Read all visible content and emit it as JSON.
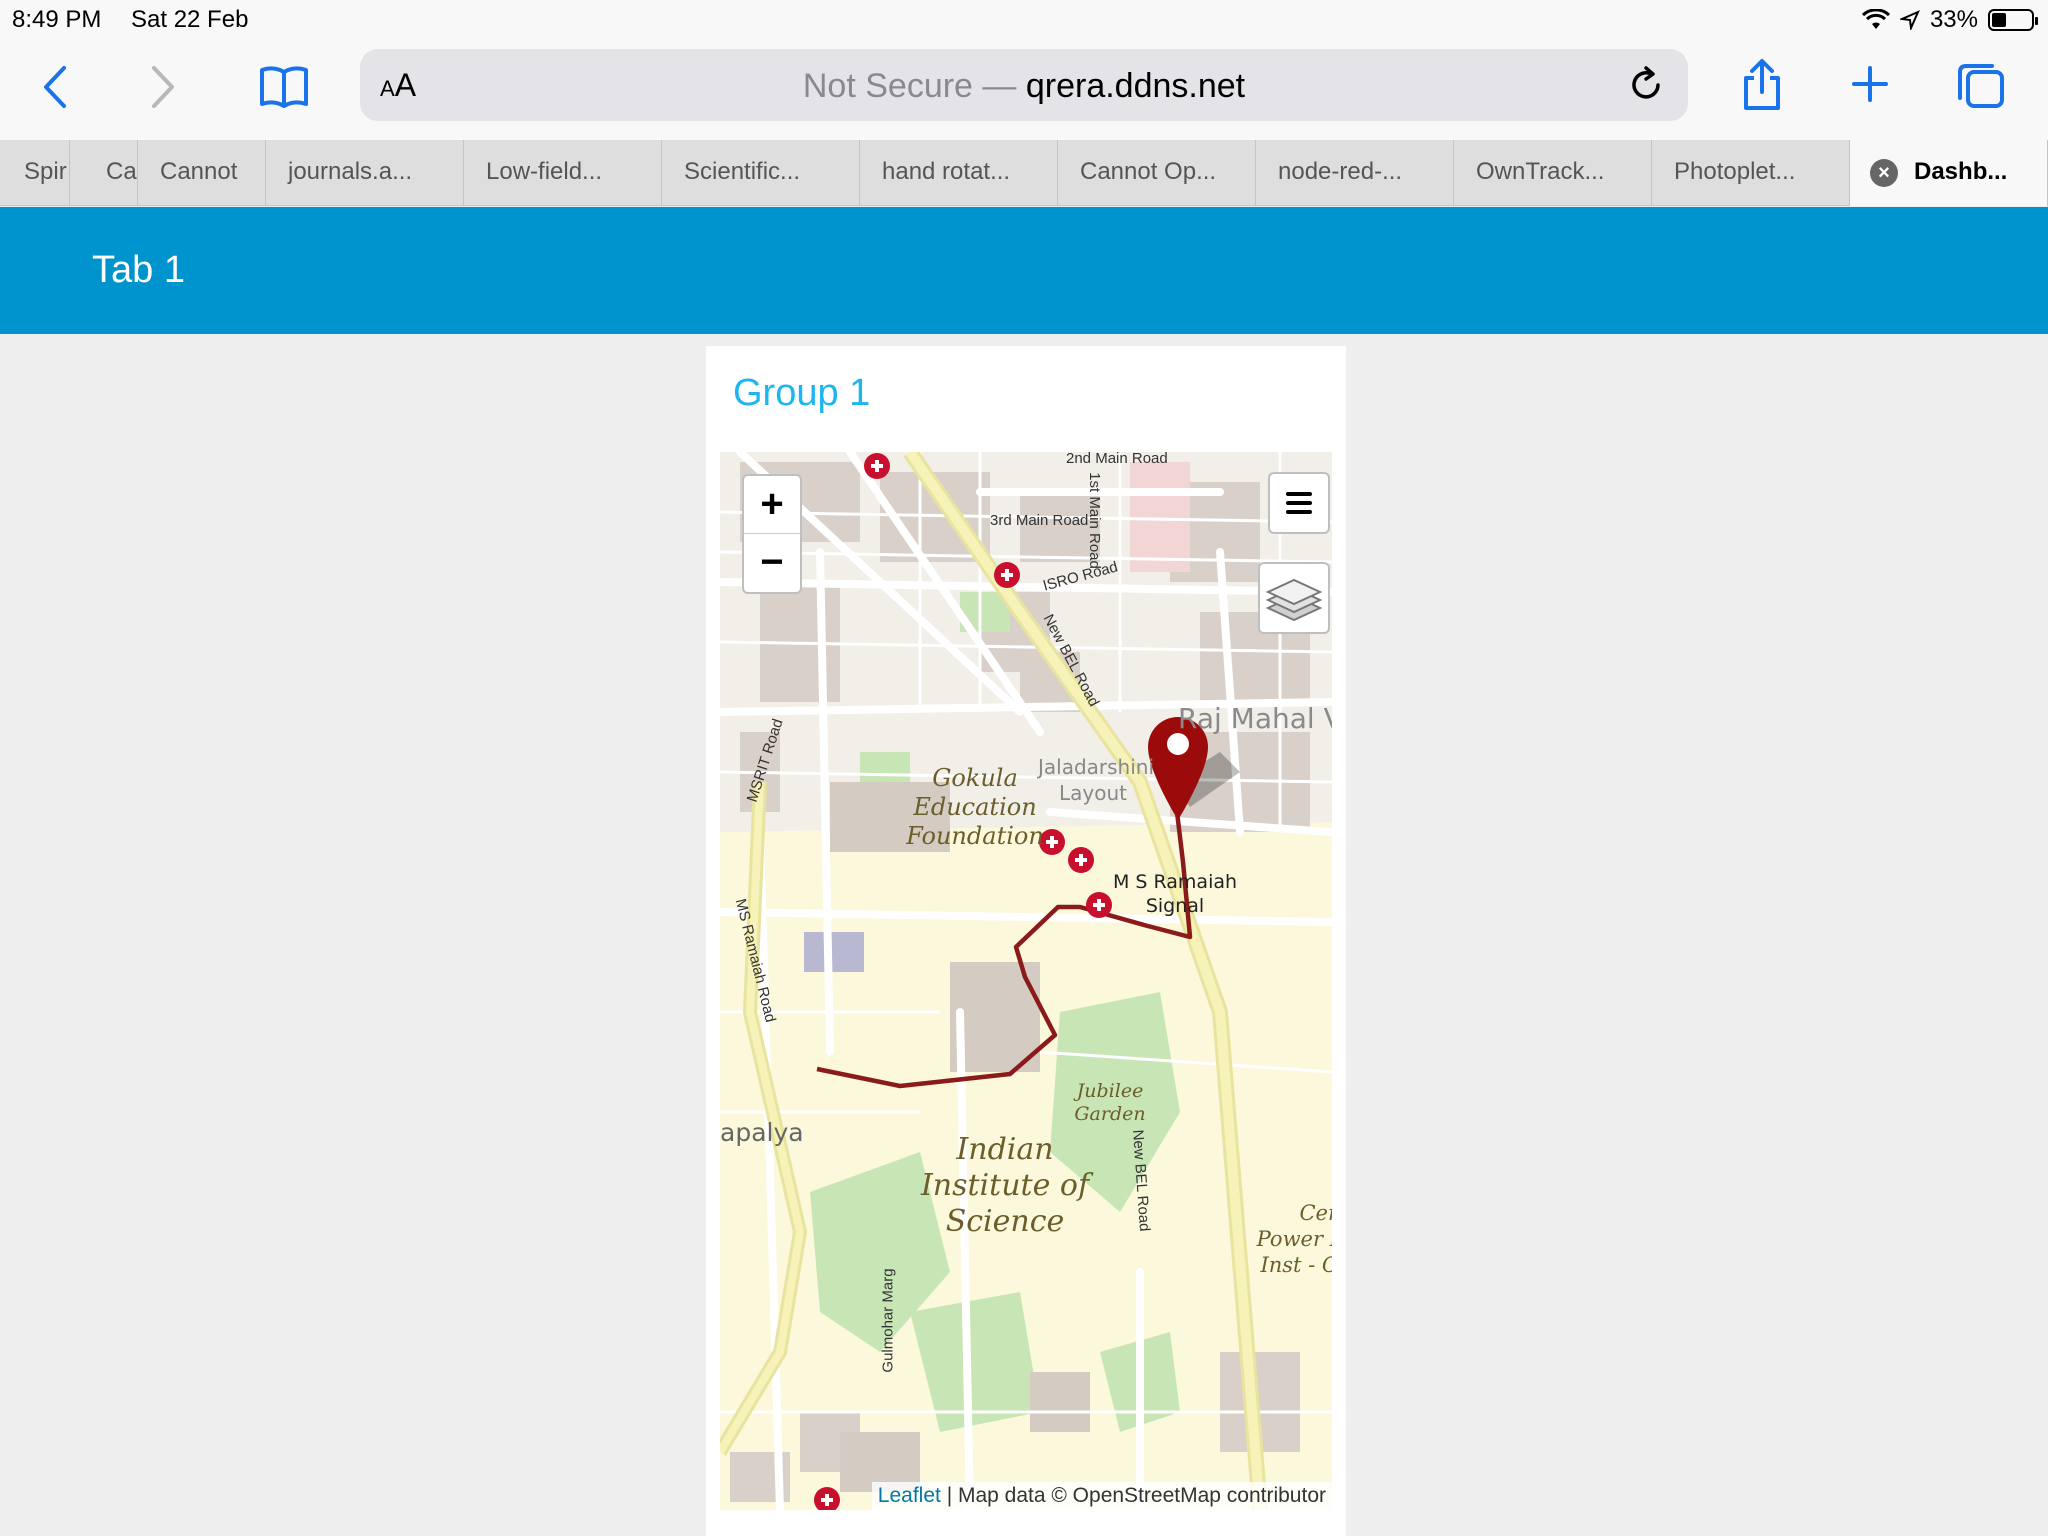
{
  "status": {
    "time": "8:49 PM",
    "date": "Sat 22 Feb",
    "battery": "33%",
    "battery_level": 0.33
  },
  "toolbar": {
    "aa": "AA",
    "not_secure": "Not Secure —",
    "domain": "qrera.ddns.net",
    "icons": [
      "back-icon",
      "forward-icon",
      "bookmarks-icon",
      "reload-icon",
      "share-icon",
      "new-tab-icon",
      "tabs-icon"
    ]
  },
  "tabs": [
    "Spir",
    "Ca",
    "Cannot",
    "journals.a...",
    "Low-field...",
    "Scientific...",
    "hand rotat...",
    "Cannot Op...",
    "node-red-...",
    "OwnTrack...",
    "Photoplet...",
    "Dashb..."
  ],
  "dashboard": {
    "tab_title": "Tab 1",
    "group_title": "Group 1"
  },
  "map": {
    "zoom_in": "+",
    "zoom_out": "−",
    "attribution_link": "Leaflet",
    "attribution_text": " | Map data © OpenStreetMap contributor",
    "labels": {
      "gokula": "Gokula Education Foundation",
      "iisc": "Indian Institute of Science",
      "jubilee": "Jubilee Garden",
      "jaladarshini": "Jaladarshini Layout",
      "raj_mahal": "Raj Mahal V",
      "signal": "M S Ramaiah Signal",
      "palya": "apalya",
      "power": "Cer Power I Inst - C"
    },
    "roads": {
      "new_bel": "New BEL Road",
      "ms_ramaiah": "MS Ramaiah Road",
      "msrit": "MSRIT Road",
      "isro": "ISRO Road",
      "third_main": "3rd Main Road",
      "second_main": "2nd Main Road",
      "first_main": "1st Main Road",
      "gulmohar": "Gulmohar Marg"
    },
    "colors": {
      "route": "#8b1a1a",
      "marker": "#9b0b0b",
      "accent": "#0094ce"
    }
  }
}
